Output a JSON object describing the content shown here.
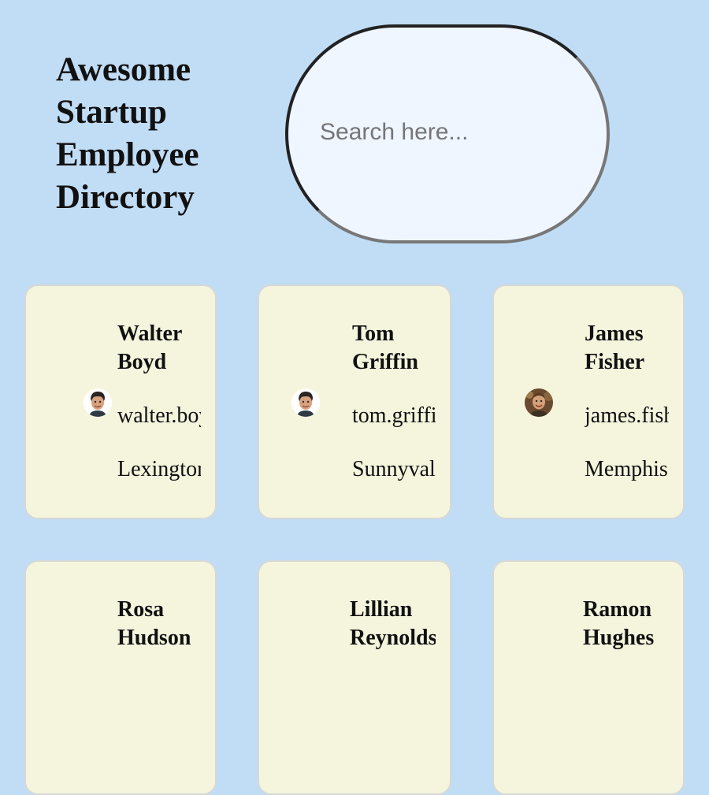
{
  "header": {
    "title_lines": [
      "Awesome",
      "Startup",
      "Employee",
      "Directory"
    ]
  },
  "search": {
    "placeholder": "Search here..."
  },
  "colors": {
    "page_background": "#c1ddf6",
    "card_background": "#f5f5de",
    "search_background": "#eff6ff"
  },
  "employees": [
    {
      "name_first": "Walter",
      "name_last": "Boyd",
      "email": "walter.boyd@example.com",
      "city": "Lexington",
      "avatar_icon": "avatar-photo-icon"
    },
    {
      "name_first": "Tom",
      "name_last": "Griffin",
      "email": "tom.griffin@example.com",
      "city": "Sunnyvale",
      "avatar_icon": "avatar-photo-icon"
    },
    {
      "name_first": "James",
      "name_last": "Fisher",
      "email": "james.fisher@example.com",
      "city": "Memphis",
      "avatar_icon": "avatar-photo-icon"
    },
    {
      "name_first": "Rosa",
      "name_last": "Hudson",
      "email": "",
      "city": "",
      "avatar_icon": "avatar-photo-icon"
    },
    {
      "name_first": "Lillian",
      "name_last": "Reynolds",
      "email": "",
      "city": "",
      "avatar_icon": "avatar-photo-icon"
    },
    {
      "name_first": "Ramon",
      "name_last": "Hughes",
      "email": "",
      "city": "",
      "avatar_icon": "avatar-photo-icon"
    }
  ]
}
